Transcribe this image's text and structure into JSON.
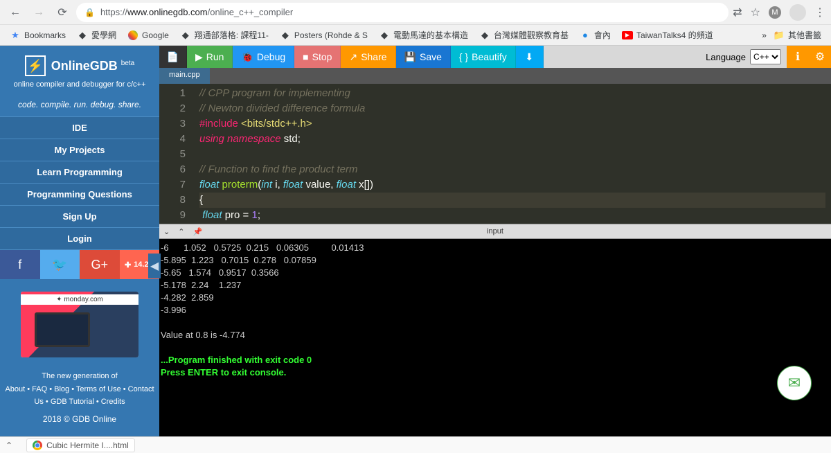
{
  "browser": {
    "url_prefix": "https://",
    "url_host": "www.onlinegdb.com",
    "url_path": "/online_c++_compiler"
  },
  "bookmarks": [
    {
      "label": "Bookmarks",
      "icon": "star"
    },
    {
      "label": "愛學網",
      "icon": "generic"
    },
    {
      "label": "Google",
      "icon": "google"
    },
    {
      "label": "翔通部落格: 課程11-",
      "icon": "generic"
    },
    {
      "label": "Posters (Rohde & S",
      "icon": "generic"
    },
    {
      "label": "電動馬達的基本構造",
      "icon": "generic"
    },
    {
      "label": "台灣媒體觀察教育基",
      "icon": "generic"
    },
    {
      "label": "會內",
      "icon": "circle"
    },
    {
      "label": "TaiwanTalks4 的頻道",
      "icon": "youtube"
    }
  ],
  "bookmarks_folder": "其他書籤",
  "sidebar": {
    "logo": "OnlineGDB",
    "beta": "beta",
    "tagline": "online compiler and debugger for c/c++",
    "motto": "code. compile. run. debug. share.",
    "nav": [
      "IDE",
      "My Projects",
      "Learn Programming",
      "Programming Questions",
      "Sign Up",
      "Login"
    ],
    "share_count": "14.2K",
    "ad_label": "monday.com",
    "footer_line1": "The new generation of",
    "footer_links": "About • FAQ • Blog • Terms of Use • Contact Us • GDB Tutorial • Credits",
    "copyright": "2018 © GDB Online"
  },
  "toolbar": {
    "run": "Run",
    "debug": "Debug",
    "stop": "Stop",
    "share": "Share",
    "save": "Save",
    "beautify": "Beautify",
    "language_label": "Language",
    "language_value": "C++"
  },
  "file_tab": "main.cpp",
  "code": {
    "lines": [
      {
        "n": 1,
        "html": "<span class='c-comment'>// CPP program for implementing</span>"
      },
      {
        "n": 2,
        "html": "<span class='c-comment'>// Newton divided difference formula</span>"
      },
      {
        "n": 3,
        "html": "<span class='c-preproc'>#include </span><span class='c-string'>&lt;bits/stdc++.h&gt;</span>"
      },
      {
        "n": 4,
        "html": "<span class='c-keyword'>using</span> <span class='c-keyword'>namespace</span> <span class='c-plain'>std;</span>"
      },
      {
        "n": 5,
        "html": ""
      },
      {
        "n": 6,
        "html": "<span class='c-comment'>// Function to find the product term</span>"
      },
      {
        "n": 7,
        "html": "<span class='c-type'>float</span> <span class='c-func'>proterm</span><span class='c-plain'>(</span><span class='c-type'>int</span> <span class='c-plain'>i, </span><span class='c-type'>float</span> <span class='c-plain'>value, </span><span class='c-type'>float</span> <span class='c-plain'>x[])</span>"
      },
      {
        "n": 8,
        "html": "<span class='c-plain'>{</span>"
      },
      {
        "n": 9,
        "html": " <span class='c-type'>float</span> <span class='c-plain'>pro = </span><span class='c-num'>1</span><span class='c-plain'>;</span>"
      }
    ]
  },
  "panel_title": "input",
  "console_output": "-6      1.052   0.5725  0.215   0.06305         0.01413\n-5.895  1.223   0.7015  0.278   0.07859\n-5.65   1.574   0.9517  0.3566\n-5.178  2.24    1.237\n-4.282  2.859\n-3.996\n\nValue at 0.8 is -4.774\n\n",
  "console_green1": "...Program finished with exit code 0",
  "console_green2": "Press ENTER to exit console.",
  "taskbar_item": "Cubic Hermite I....html"
}
